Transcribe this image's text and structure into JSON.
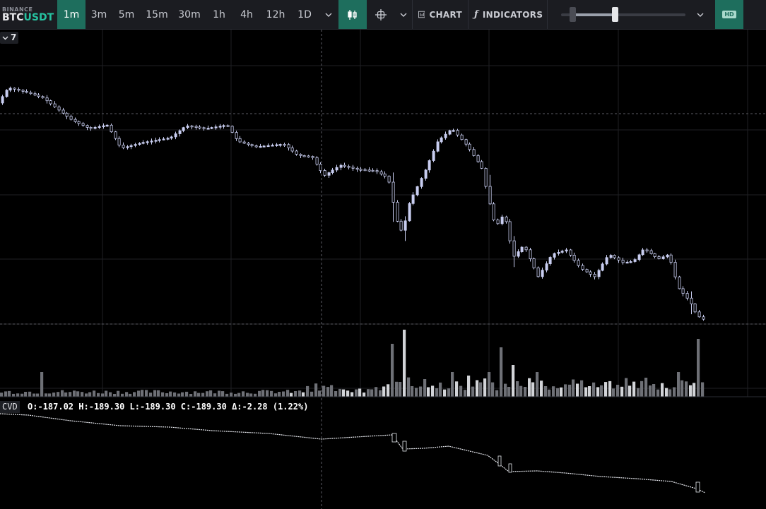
{
  "toolbar": {
    "exchange": "BINANCE",
    "pair_base": "BTC",
    "pair_quote": "USDT",
    "timeframes": [
      "1m",
      "3m",
      "5m",
      "15m",
      "30m",
      "1h",
      "4h",
      "12h",
      "1D"
    ],
    "active_timeframe": "1m",
    "chart_button": "CHART",
    "indicators_button": "INDICATORS",
    "hd_badge": "HD",
    "slider_range": [
      0.09,
      0.43
    ]
  },
  "panes": {
    "price_pane_toggle": "7",
    "cvd_label": "CVD",
    "cvd_legend": {
      "open": "O:-187.02",
      "high": "H:-189.30",
      "low": "L:-189.30",
      "close": "C:-189.30",
      "delta": "Δ:-2.28 (1.22%)"
    }
  },
  "colors": {
    "background": "#000000",
    "toolbar": "#1b1c21",
    "accent": "#1e6e5d",
    "quote": "#26c2a0",
    "candle": "#c8cdf0",
    "volume_gray": "#6e7076",
    "volume_light": "#d2d4d8",
    "grid": "#1f2024"
  }
}
